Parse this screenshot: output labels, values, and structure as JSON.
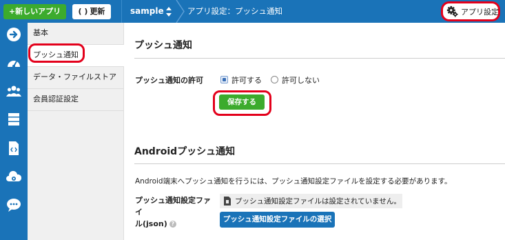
{
  "topbar": {
    "new_app_label": "+新しいアプリ",
    "refresh_icon": "(  )",
    "refresh_label": "更新",
    "app_name": "sample",
    "breadcrumb": "アプリ設定：プッシュ通知",
    "app_settings_label": "アプリ設定",
    "colors": {
      "bar": "#1a73b8",
      "green": "#3cab2d",
      "highlight": "#e3001b"
    }
  },
  "rail": {
    "icons": [
      "arrow-right-icon",
      "dashboard-icon",
      "users-icon",
      "database-icon",
      "script-icon",
      "cloud-gear-icon",
      "chat-icon"
    ]
  },
  "submenu": {
    "items": [
      {
        "label": "基本"
      },
      {
        "label": "プッシュ通知",
        "active": true
      },
      {
        "label": "データ・ファイルストア"
      },
      {
        "label": "会員認証設定"
      }
    ]
  },
  "push": {
    "title": "プッシュ通知",
    "permission_label": "プッシュ通知の許可",
    "allow_label": "許可する",
    "deny_label": "許可しない",
    "selected": "allow",
    "save_label": "保存する"
  },
  "android": {
    "title": "Androidプッシュ通知",
    "description": "Android端末へプッシュ通知を行うには、プッシュ通知設定ファイルを設定する必要があります。",
    "file_label_line1": "プッシュ通知設定ファイ",
    "file_label_line2": "ル(json)",
    "help": "?",
    "file_status": "プッシュ通知設定ファイルは設定されていません。",
    "select_button": "プッシュ通知設定ファイルの選択"
  }
}
